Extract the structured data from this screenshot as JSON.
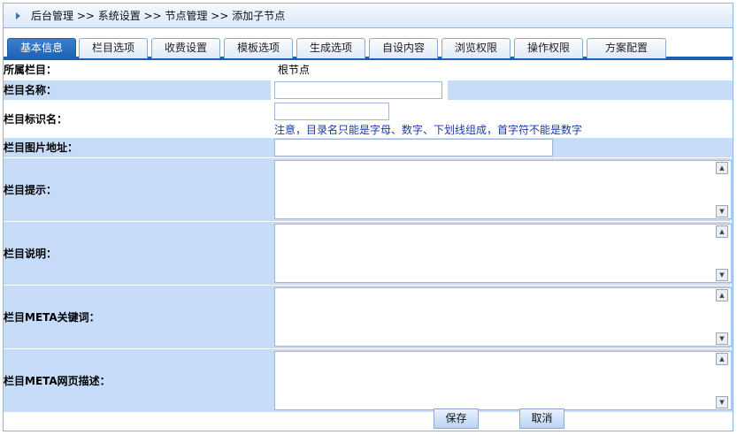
{
  "breadcrumb": {
    "path": "后台管理 >> 系统设置 >> 节点管理 >> 添加子节点"
  },
  "tabs": [
    {
      "label": "基本信息",
      "active": true
    },
    {
      "label": "栏目选项"
    },
    {
      "label": "收费设置"
    },
    {
      "label": "模板选项"
    },
    {
      "label": "生成选项"
    },
    {
      "label": "自设内容"
    },
    {
      "label": "浏览权限"
    },
    {
      "label": "操作权限"
    },
    {
      "label": "方案配置"
    }
  ],
  "form": {
    "parent_label": "所属栏目：",
    "parent_value": "根节点",
    "name_label": "栏目名称：",
    "name_value": "",
    "identifier_label": "栏目标识名：",
    "identifier_value": "",
    "identifier_note": "注意，目录名只能是字母、数字、下划线组成，首字符不能是数字",
    "image_label": "栏目图片地址：",
    "image_value": "",
    "tip_label": "栏目提示：",
    "desc_label": "栏目说明：",
    "meta_keywords_label": "栏目META关键词：",
    "meta_desc_label": "栏目META网页描述："
  },
  "actions": {
    "save": "保存",
    "cancel": "取消"
  },
  "colors": {
    "accent": "#1b5fb0",
    "row_blue": "#c7dcf8",
    "note": "#1a3aaa"
  }
}
